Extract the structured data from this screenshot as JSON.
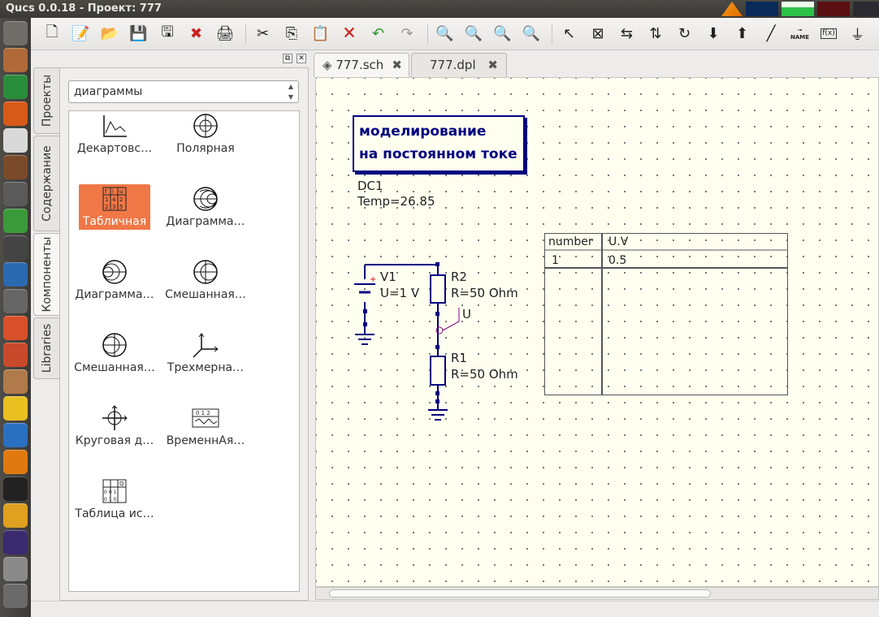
{
  "window": {
    "title": "Qucs 0.0.18 - Проект: 777"
  },
  "launcher": {
    "apps": [
      {
        "icon": "dash-icon",
        "color": "#706c68"
      },
      {
        "icon": "files-icon",
        "color": "#b06a3a"
      },
      {
        "icon": "chrome-icon",
        "color": "#2a8d3c"
      },
      {
        "icon": "firefox-icon",
        "color": "#d85a18"
      },
      {
        "icon": "document-icon",
        "color": "#d9d9d9"
      },
      {
        "icon": "pen-icon",
        "color": "#7a4a2a"
      },
      {
        "icon": "tools-icon",
        "color": "#5a5a5a"
      },
      {
        "icon": "spreadsheet-icon",
        "color": "#3a9a3a"
      },
      {
        "icon": "printer-icon",
        "color": "#444"
      },
      {
        "icon": "network-icon",
        "color": "#2a6ab0"
      },
      {
        "icon": "update-icon",
        "color": "#666"
      },
      {
        "icon": "software-center-icon",
        "color": "#d8502a"
      },
      {
        "icon": "settings-icon",
        "color": "#c84a2a"
      },
      {
        "icon": "disk-icon",
        "color": "#b07a4a"
      },
      {
        "icon": "music-icon",
        "color": "#e8c020"
      },
      {
        "icon": "qbittorrent-icon",
        "color": "#2a70c0"
      },
      {
        "icon": "vlc-icon",
        "color": "#e07a10"
      },
      {
        "icon": "terminal-icon",
        "color": "#222"
      },
      {
        "icon": "qucs-icon",
        "color": "#e0a020"
      },
      {
        "icon": "eclipse-icon",
        "color": "#3a2a70"
      },
      {
        "icon": "drive-icon",
        "color": "#8a8a8a"
      },
      {
        "icon": "trash-icon",
        "color": "#6a6a6a"
      }
    ]
  },
  "toolbar": {
    "buttons": [
      {
        "icon": "new-file-icon",
        "glyph": "🗋"
      },
      {
        "icon": "new-text-icon",
        "glyph": "📝"
      },
      {
        "icon": "open-icon",
        "glyph": "📂"
      },
      {
        "icon": "save-icon",
        "glyph": "💾"
      },
      {
        "icon": "save-all-icon",
        "glyph": "🖫"
      },
      {
        "icon": "close-doc-icon",
        "glyph": "✖"
      },
      {
        "icon": "print-icon",
        "glyph": "🖨"
      },
      {
        "sep": true
      },
      {
        "icon": "cut-icon",
        "glyph": "✂"
      },
      {
        "icon": "copy-icon",
        "glyph": "⎘"
      },
      {
        "icon": "paste-icon",
        "glyph": "📋"
      },
      {
        "icon": "delete-icon",
        "glyph": "🗙"
      },
      {
        "icon": "undo-icon",
        "glyph": "↶"
      },
      {
        "icon": "redo-icon",
        "glyph": "↷"
      },
      {
        "sep": true
      },
      {
        "icon": "view-all-icon",
        "glyph": "🔍"
      },
      {
        "icon": "view-one-icon",
        "glyph": "🔍"
      },
      {
        "icon": "zoom-in-icon",
        "glyph": "🔍"
      },
      {
        "icon": "zoom-out-icon",
        "glyph": "🔍"
      },
      {
        "sep": true
      },
      {
        "icon": "select-icon",
        "glyph": "↖"
      },
      {
        "icon": "edit-activate-icon",
        "glyph": "⊠"
      },
      {
        "icon": "mirror-x-icon",
        "glyph": "⇆"
      },
      {
        "icon": "mirror-y-icon",
        "glyph": "⇅"
      },
      {
        "icon": "rotate-icon",
        "glyph": "↻"
      },
      {
        "icon": "enter-subcircuit-icon",
        "glyph": "⬇"
      },
      {
        "icon": "leave-subcircuit-icon",
        "glyph": "⬆"
      },
      {
        "icon": "wire-icon",
        "glyph": "╱"
      },
      {
        "icon": "wire-label-icon",
        "glyph": "⊸"
      },
      {
        "icon": "equation-icon",
        "glyph": "ƒ"
      },
      {
        "icon": "ground-icon",
        "glyph": "⏚"
      }
    ]
  },
  "toolbar_labels": {
    "name": "NAME",
    "equation": "f(x)"
  },
  "sidebar": {
    "tabs": [
      {
        "label": "Проекты"
      },
      {
        "label": "Содержание"
      },
      {
        "label": "Компоненты"
      },
      {
        "label": "Libraries"
      }
    ],
    "combo_value": "диаграммы",
    "components": [
      {
        "label": "Декартовс…",
        "icon": "cartesian-icon"
      },
      {
        "label": "Полярная",
        "icon": "polar-icon"
      },
      {
        "label": "Табличная",
        "icon": "tabular-icon",
        "selected": true
      },
      {
        "label": "Диаграмма…",
        "icon": "smith-chart-icon"
      },
      {
        "label": "Диаграмма…",
        "icon": "admittance-chart-icon"
      },
      {
        "label": "Смешанная…",
        "icon": "polar-smith-icon"
      },
      {
        "label": "Смешанная…",
        "icon": "smith-polar-icon"
      },
      {
        "label": "Трехмерна…",
        "icon": "3d-axes-icon"
      },
      {
        "label": "Круговая д…",
        "icon": "locus-curve-icon"
      },
      {
        "label": "ВременнАя…",
        "icon": "timing-diagram-icon"
      },
      {
        "label": "Таблица ис…",
        "icon": "truth-table-icon"
      }
    ]
  },
  "documents": {
    "tabs": [
      {
        "label": "777.sch",
        "active": true
      },
      {
        "label": "777.dpl",
        "active": false
      }
    ]
  },
  "schematic": {
    "title_lines": [
      "моделирование",
      "на постоянном токе"
    ],
    "dc_name": "DC1",
    "dc_temp": "Temp=26.85",
    "v1_name": "V1",
    "v1_value": "U=1 V",
    "r2_name": "R2",
    "r2_value": "R=50 Ohm",
    "r1_name": "R1",
    "r1_value": "R=50 Ohm",
    "node_label": "U",
    "table": {
      "headers": [
        "number",
        "U.V"
      ],
      "rows": [
        [
          "1",
          "0.5"
        ]
      ]
    }
  },
  "colors": {
    "accent": "#f07746",
    "title_box": "#000080",
    "wire": "#000080",
    "node_label": "#800080"
  }
}
